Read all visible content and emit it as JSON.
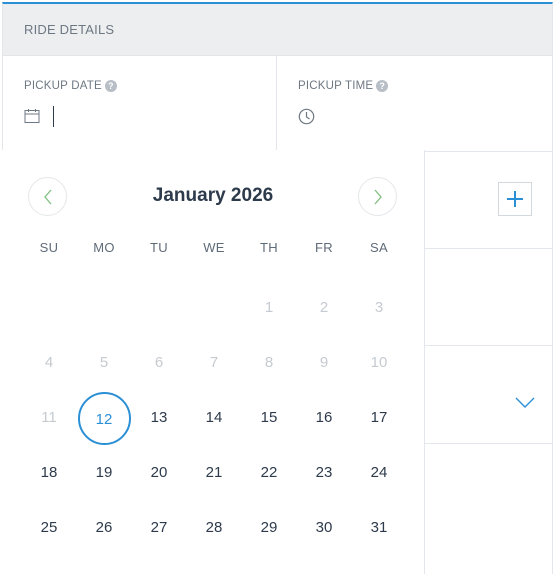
{
  "header": {
    "title": "RIDE DETAILS"
  },
  "pickup_date": {
    "label": "PICKUP DATE",
    "icon": "calendar-icon",
    "help_icon": "help-icon"
  },
  "pickup_time": {
    "label": "PICKUP TIME",
    "icon": "clock-icon",
    "help_icon": "help-icon"
  },
  "side": {
    "add_icon": "plus-icon",
    "dropdown_icon": "chevron-down-icon"
  },
  "calendar": {
    "month": "January 2026",
    "weekdays": [
      "SU",
      "MO",
      "TU",
      "WE",
      "TH",
      "FR",
      "SA"
    ],
    "weeks": [
      [
        "",
        "",
        "",
        "",
        "1",
        "2",
        "3"
      ],
      [
        "4",
        "5",
        "6",
        "7",
        "8",
        "9",
        "10"
      ],
      [
        "11",
        "12",
        "13",
        "14",
        "15",
        "16",
        "17"
      ],
      [
        "18",
        "19",
        "20",
        "21",
        "22",
        "23",
        "24"
      ],
      [
        "25",
        "26",
        "27",
        "28",
        "29",
        "30",
        "31"
      ]
    ],
    "selected": "12",
    "disabled": [
      "1",
      "2",
      "3",
      "4",
      "5",
      "6",
      "7",
      "8",
      "9",
      "10",
      "11"
    ]
  },
  "colors": {
    "accent": "#2b8fd6",
    "text": "#2d3a4b",
    "muted": "#c5cbd1",
    "header_bg": "#eceef0"
  }
}
